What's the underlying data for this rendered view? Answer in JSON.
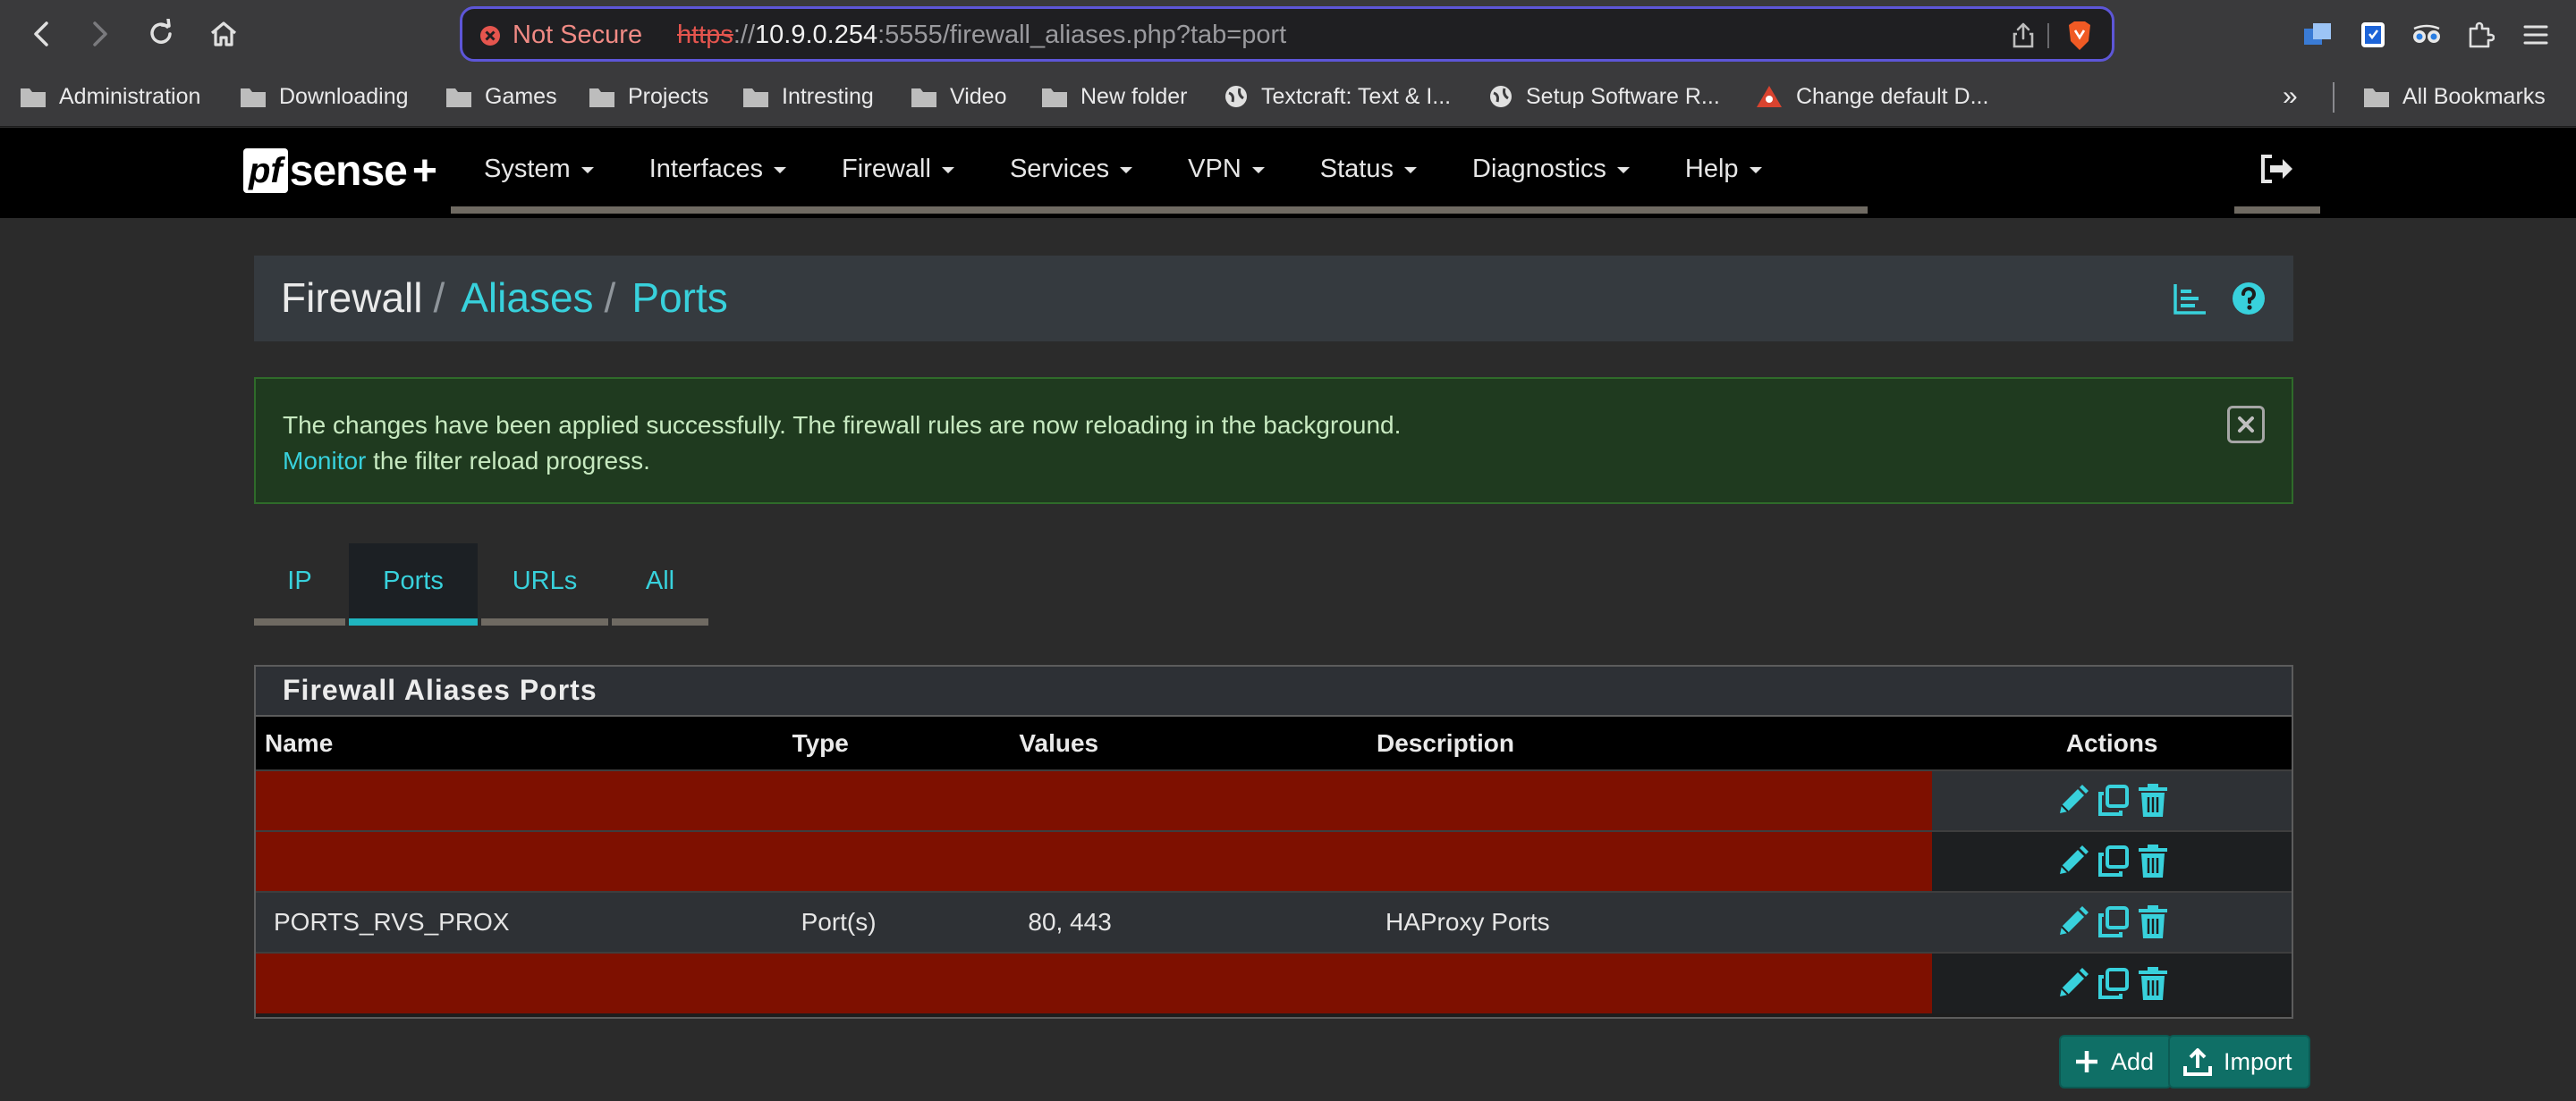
{
  "browser": {
    "security_label": "Not Secure",
    "url_protocol": "https",
    "url_sep": "://",
    "url_host": "10.9.0.254",
    "url_rest": ":5555/firewall_aliases.php?tab=port"
  },
  "bookmarks": [
    {
      "label": "Administration",
      "icon": "folder-icon"
    },
    {
      "label": "Downloading",
      "icon": "folder-icon"
    },
    {
      "label": "Games",
      "icon": "folder-icon"
    },
    {
      "label": "Projects",
      "icon": "folder-icon"
    },
    {
      "label": "Intresting",
      "icon": "folder-icon"
    },
    {
      "label": "Video",
      "icon": "folder-icon"
    },
    {
      "label": "New folder",
      "icon": "folder-icon"
    },
    {
      "label": "Textcraft: Text & I...",
      "icon": "globe-icon"
    },
    {
      "label": "Setup Software R...",
      "icon": "globe-icon"
    },
    {
      "label": "Change default D...",
      "icon": "site-icon"
    }
  ],
  "bookmarks_overflow": "»",
  "all_bookmarks": "All Bookmarks",
  "navbar": {
    "logo_box": "pf",
    "logo_text": "sense",
    "logo_plus": "+",
    "menu": [
      "System",
      "Interfaces",
      "Firewall",
      "Services",
      "VPN",
      "Status",
      "Diagnostics",
      "Help"
    ]
  },
  "breadcrumb": {
    "home": "Firewall",
    "items": [
      "Aliases",
      "Ports"
    ],
    "separator": "/"
  },
  "alert": {
    "message": "The changes have been applied successfully. The firewall rules are now reloading in the background.",
    "link_text": "Monitor",
    "link_suffix": " the filter reload progress."
  },
  "tabs": [
    {
      "label": "IP",
      "active": false
    },
    {
      "label": "Ports",
      "active": true
    },
    {
      "label": "URLs",
      "active": false
    },
    {
      "label": "All",
      "active": false
    }
  ],
  "panel": {
    "title": "Firewall Aliases Ports",
    "columns": [
      "Name",
      "Type",
      "Values",
      "Description",
      "Actions"
    ],
    "rows": [
      {
        "redacted": true,
        "name": "",
        "type": "",
        "values": "",
        "description": ""
      },
      {
        "redacted": true,
        "name": "",
        "type": "",
        "values": "",
        "description": ""
      },
      {
        "redacted": false,
        "name": "PORTS_RVS_PROX",
        "type": "Port(s)",
        "values": "80, 443",
        "description": "HAProxy Ports"
      },
      {
        "redacted": true,
        "name": "",
        "type": "",
        "values": "",
        "description": ""
      }
    ]
  },
  "buttons": {
    "add": "Add",
    "import": "Import"
  },
  "colors": {
    "accent": "#38d1dc",
    "button": "#0f6f66",
    "redaction": "#7e1000",
    "alert_bg": "#1f3a1f"
  }
}
